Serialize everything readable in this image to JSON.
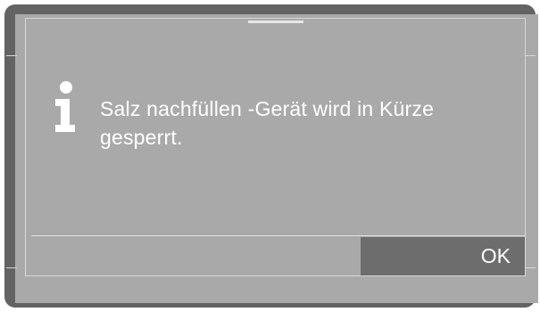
{
  "dialog": {
    "icon": "info-icon",
    "message": "Salz nachfüllen -Gerät wird in Kürze gesperrt.",
    "ok_label": "OK"
  },
  "colors": {
    "bezel": "#636363",
    "screen": "#a9a9a9",
    "button": "#6d6d6d",
    "text": "#ffffff"
  }
}
